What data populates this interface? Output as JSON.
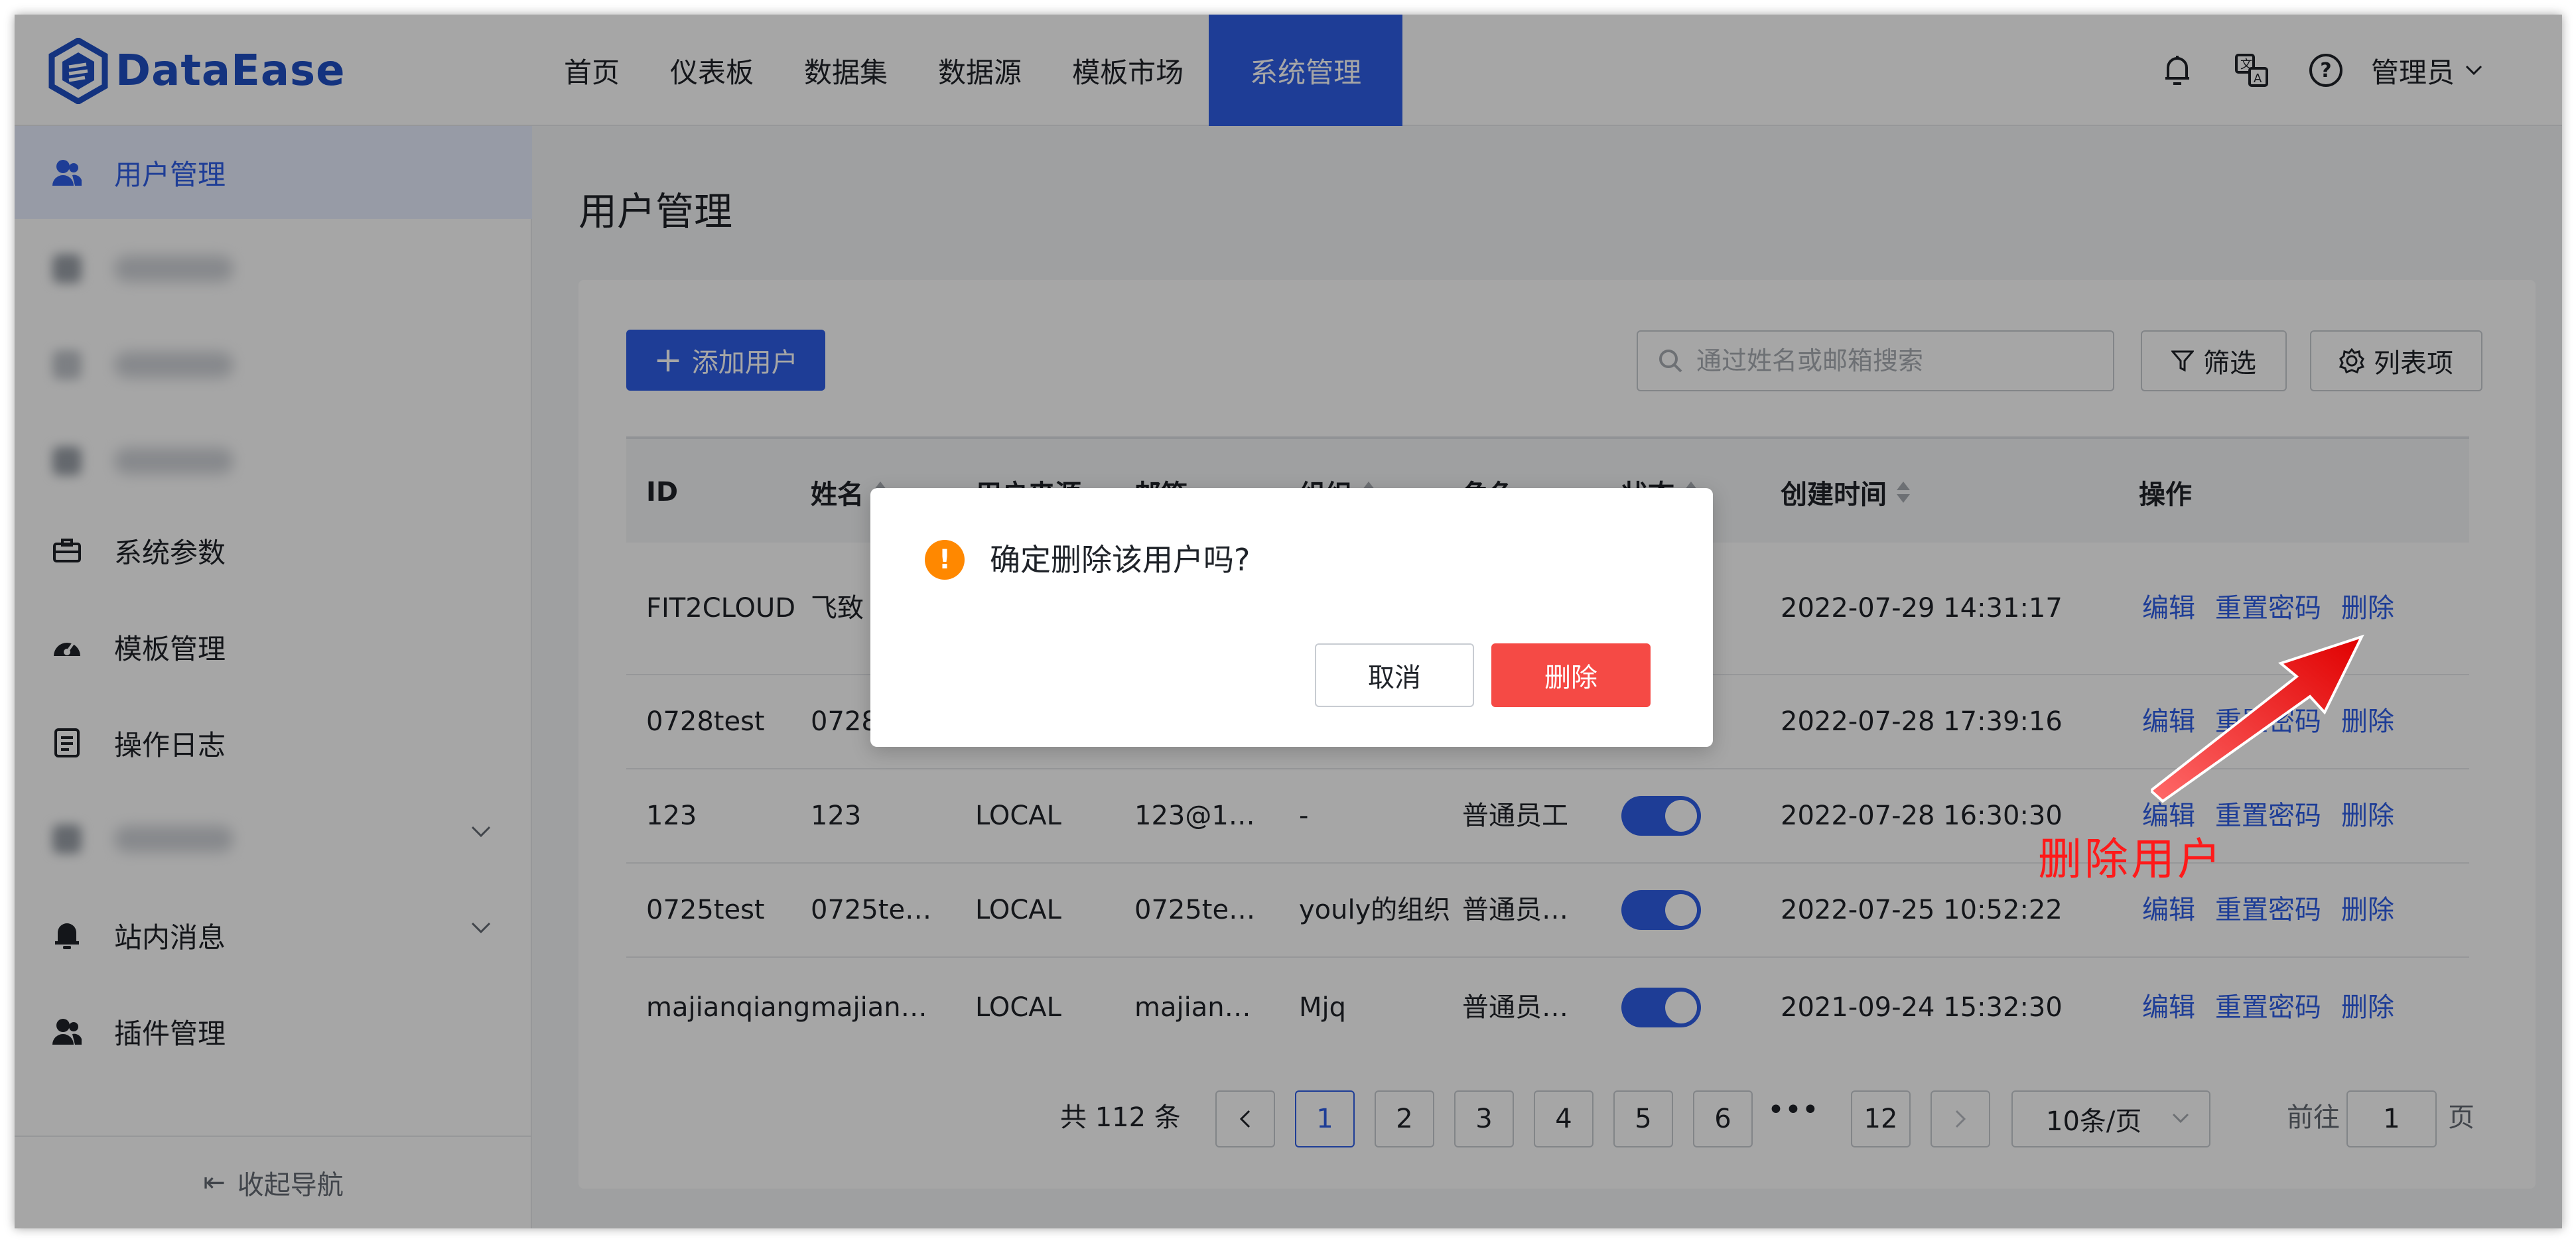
{
  "app": {
    "logo_text": "DataEase"
  },
  "nav": {
    "items": [
      {
        "label": "首页"
      },
      {
        "label": "仪表板"
      },
      {
        "label": "数据集"
      },
      {
        "label": "数据源"
      },
      {
        "label": "模板市场"
      },
      {
        "label": "系统管理",
        "active": true
      }
    ]
  },
  "header": {
    "user_label": "管理员",
    "icons": [
      "bell-icon",
      "translate-icon",
      "help-icon"
    ]
  },
  "sidebar": {
    "items": [
      {
        "label": "用户管理",
        "icon": "user-icon",
        "active": true
      },
      {
        "label": "",
        "icon": "blurred-icon",
        "blurred": true
      },
      {
        "label": "",
        "icon": "blurred-icon",
        "blurred": true
      },
      {
        "label": "",
        "icon": "blurred-icon",
        "blurred": true
      },
      {
        "label": "系统参数",
        "icon": "briefcase-icon"
      },
      {
        "label": "模板管理",
        "icon": "dashboard-icon"
      },
      {
        "label": "操作日志",
        "icon": "log-icon"
      },
      {
        "label": "",
        "icon": "blurred-icon",
        "blurred": true,
        "expandable": true
      },
      {
        "label": "站内消息",
        "icon": "bell-icon",
        "expandable": true
      },
      {
        "label": "插件管理",
        "icon": "plugin-icon"
      }
    ],
    "collapse_label": "收起导航"
  },
  "page": {
    "title": "用户管理"
  },
  "toolbar": {
    "add_label": "添加用户",
    "search_placeholder": "通过姓名或邮箱搜索",
    "filter_label": "筛选",
    "columns_label": "列表项"
  },
  "table": {
    "headers": [
      "ID",
      "姓名",
      "用户来源",
      "邮箱",
      "组织",
      "角色",
      "状态",
      "创建时间",
      "操作"
    ],
    "actions": {
      "edit": "编辑",
      "reset_password": "重置密码",
      "delete": "删除"
    },
    "rows": [
      {
        "id": "FIT2CLOUD",
        "name": "飞致",
        "source": "",
        "email": "",
        "org": "",
        "role": "",
        "status_on": true,
        "created": "2022-07-29 14:31:17"
      },
      {
        "id": "0728test",
        "name": "0728",
        "source": "",
        "email": "",
        "org": "",
        "role": "",
        "status_on": true,
        "created": "2022-07-28 17:39:16"
      },
      {
        "id": "123",
        "name": "123",
        "source": "LOCAL",
        "email": "123@1…",
        "org": "-",
        "role": "普通员工",
        "status_on": true,
        "created": "2022-07-28 16:30:30"
      },
      {
        "id": "0725test",
        "name": "0725te…",
        "source": "LOCAL",
        "email": "0725te…",
        "org": "youly的组织",
        "role": "普通员…",
        "status_on": true,
        "created": "2022-07-25 10:52:22"
      },
      {
        "id": "majianqiang",
        "name": "majian…",
        "source": "LOCAL",
        "email": "majian…",
        "org": "Mjq",
        "role": "普通员…",
        "status_on": true,
        "created": "2021-09-24 15:32:30"
      }
    ]
  },
  "pagination": {
    "total_label": "共 112 条",
    "pages": [
      "1",
      "2",
      "3",
      "4",
      "5",
      "6",
      "12"
    ],
    "current": "1",
    "ellipsis": "•••",
    "page_size": "10条/页",
    "goto_label": "前往",
    "goto_value": "1",
    "goto_suffix": "页"
  },
  "dialog": {
    "message": "确定删除该用户吗?",
    "cancel_label": "取消",
    "confirm_label": "删除"
  },
  "annotation": {
    "text": "删除用户",
    "color": "#ff1a1a"
  },
  "colors": {
    "primary": "#2e5ee6",
    "danger": "#f54a45",
    "warning": "#ff8800"
  }
}
